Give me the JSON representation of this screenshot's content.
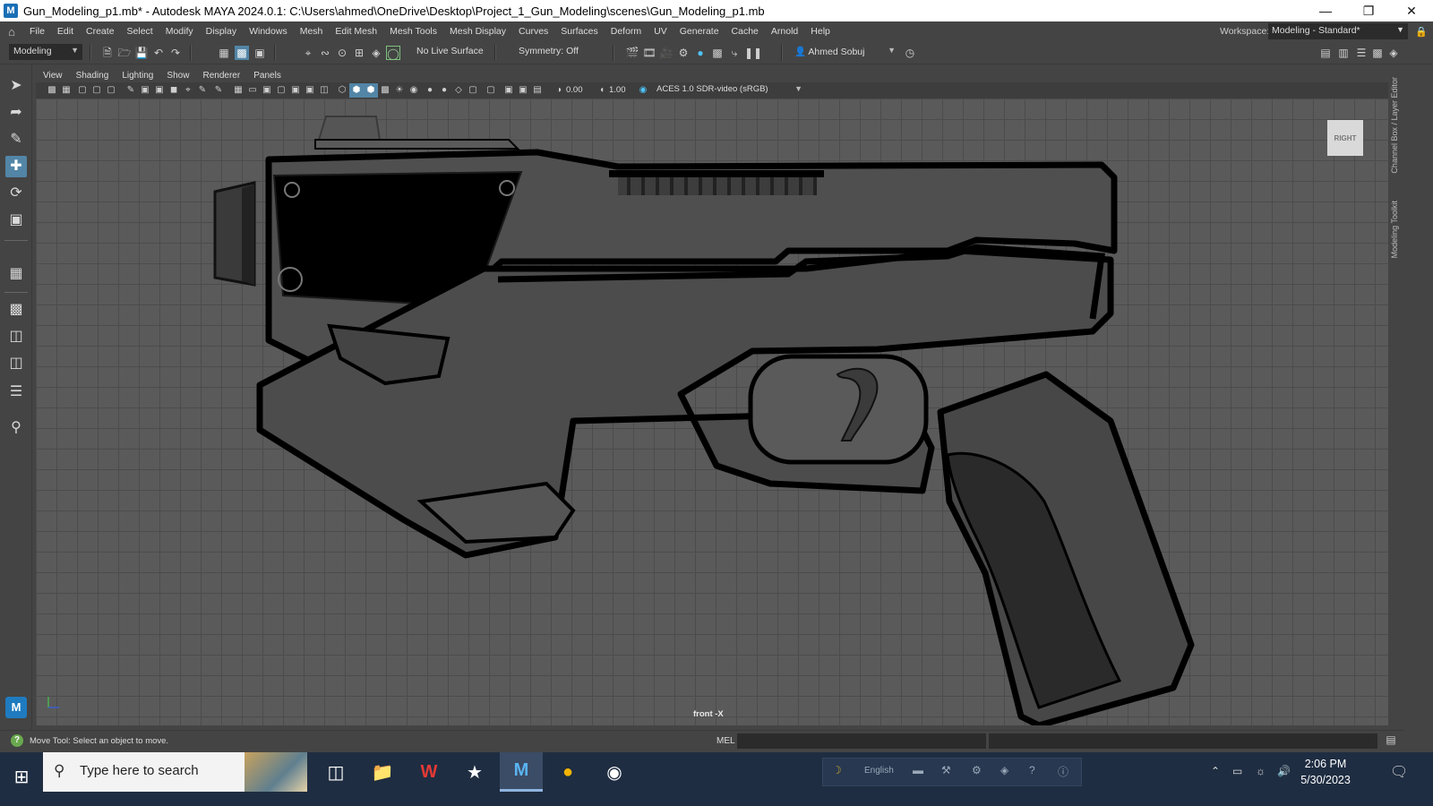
{
  "window": {
    "title": "Gun_Modeling_p1.mb* - Autodesk MAYA 2024.0.1: C:\\Users\\ahmed\\OneDrive\\Desktop\\Project_1_Gun_Modeling\\scenes\\Gun_Modeling_p1.mb",
    "app_icon": "M"
  },
  "menubar": {
    "items": [
      "File",
      "Edit",
      "Create",
      "Select",
      "Modify",
      "Display",
      "Windows",
      "Mesh",
      "Edit Mesh",
      "Mesh Tools",
      "Mesh Display",
      "Curves",
      "Surfaces",
      "Deform",
      "UV",
      "Generate",
      "Cache",
      "Arnold",
      "Help"
    ],
    "workspace_label": "Workspace:",
    "workspace_value": "Modeling - Standard*"
  },
  "statusline": {
    "menuset": "Modeling",
    "live_surface": "No Live Surface",
    "symmetry": "Symmetry: Off",
    "user": "Ahmed Sobuj"
  },
  "panel": {
    "menus": [
      "View",
      "Shading",
      "Lighting",
      "Show",
      "Renderer",
      "Panels"
    ],
    "exposure": "0.00",
    "gamma": "1.00",
    "color_space": "ACES 1.0 SDR-video (sRGB)",
    "camera_label": "front -X",
    "viewcube_label": "RIGHT"
  },
  "right_tabs": [
    "Channel Box / Layer Editor",
    "Modeling Toolkit"
  ],
  "helpline": {
    "text": "Move Tool: Select an object to move.",
    "mel_label": "MEL"
  },
  "taskbar": {
    "search_placeholder": "Type here to search",
    "tray_language": "English",
    "time": "2:06 PM",
    "date": "5/30/2023"
  },
  "colors": {
    "viewport_bg": "#5a5a5a",
    "active_tool": "#5285a6",
    "model_fill": "#4f4f4f",
    "model_outline": "#000000"
  }
}
